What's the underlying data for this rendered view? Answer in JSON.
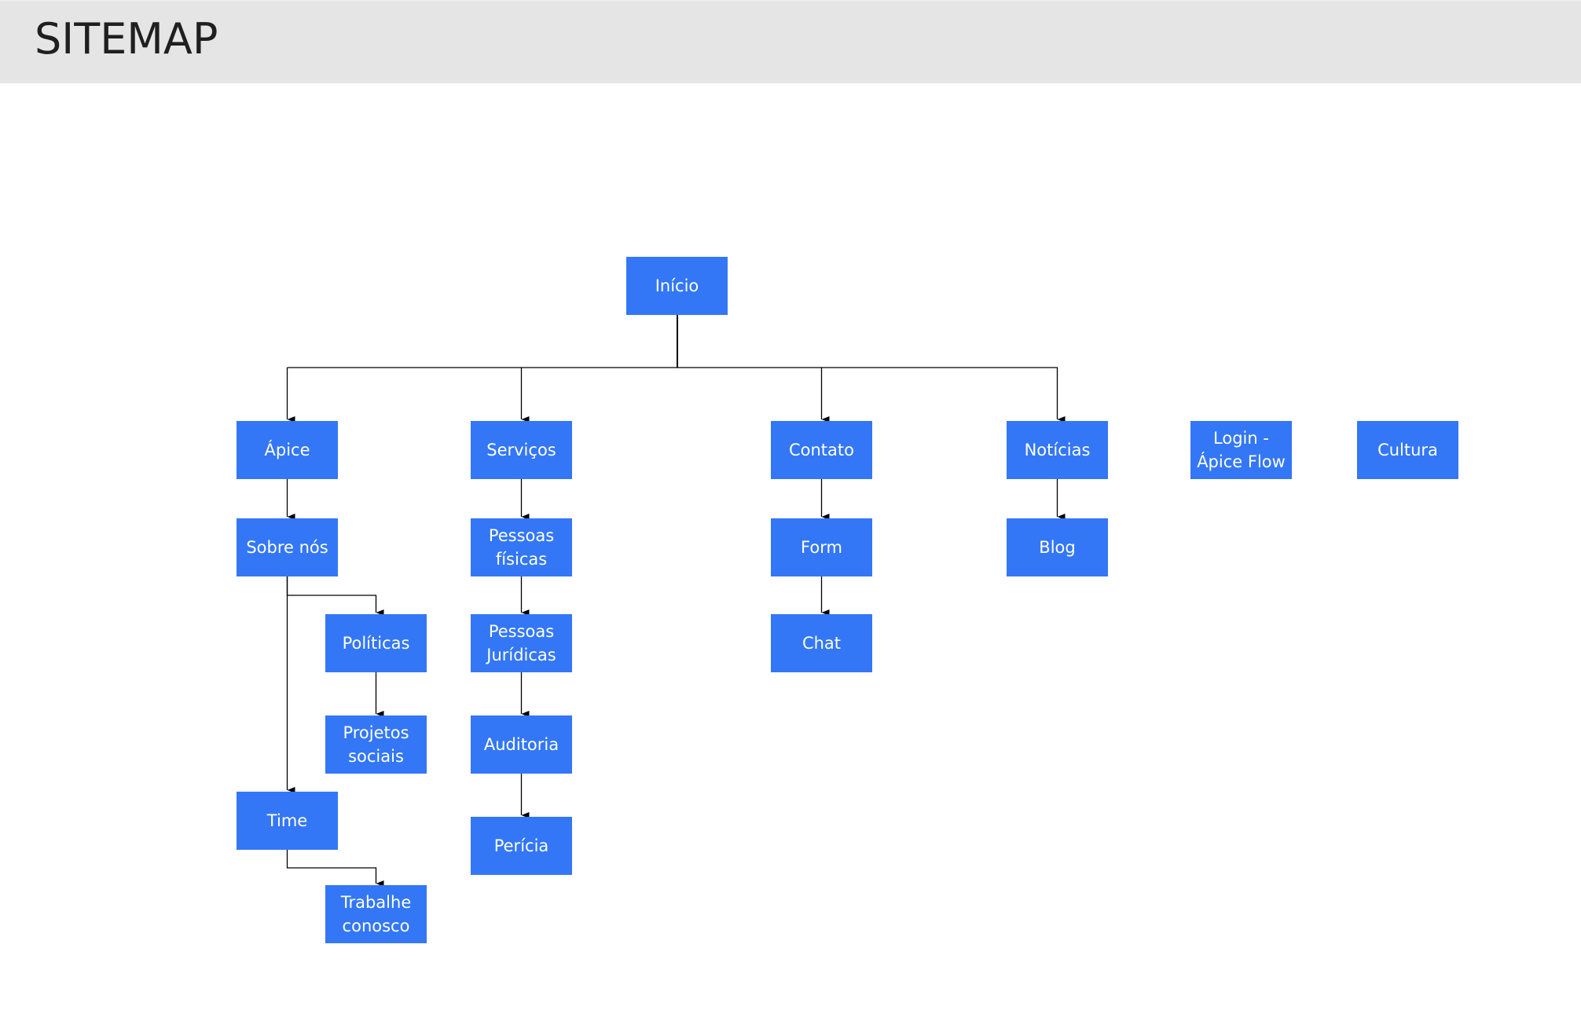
{
  "header": {
    "title": "SITEMAP"
  },
  "colors": {
    "node_fill": "#3377f6",
    "node_text": "#ffffff",
    "header_bg": "#e5e5e5",
    "connector": "#000000"
  },
  "sitemap": {
    "root": {
      "id": "inicio",
      "label": "Início"
    },
    "nodes": {
      "apice": {
        "label": "Ápice",
        "parent": "inicio"
      },
      "servicos": {
        "label": "Serviços",
        "parent": "inicio"
      },
      "contato": {
        "label": "Contato",
        "parent": "inicio"
      },
      "noticias": {
        "label": "Notícias",
        "parent": "inicio"
      },
      "login": {
        "label": "Login -\nÁpice Flow",
        "parent": null
      },
      "cultura": {
        "label": "Cultura",
        "parent": null
      },
      "sobre_nos": {
        "label": "Sobre nós",
        "parent": "apice"
      },
      "politicas": {
        "label": "Políticas",
        "parent": "sobre_nos"
      },
      "projetos_sociais": {
        "label": "Projetos\nsociais",
        "parent": "politicas"
      },
      "time": {
        "label": "Time",
        "parent": "sobre_nos"
      },
      "trabalhe_conosco": {
        "label": "Trabalhe\nconosco",
        "parent": "time"
      },
      "pessoas_fisicas": {
        "label": "Pessoas\nfísicas",
        "parent": "servicos"
      },
      "pessoas_juridicas": {
        "label": "Pessoas\nJurídicas",
        "parent": "pessoas_fisicas"
      },
      "auditoria": {
        "label": "Auditoria",
        "parent": "pessoas_juridicas"
      },
      "pericia": {
        "label": "Perícia",
        "parent": "auditoria"
      },
      "form": {
        "label": "Form",
        "parent": "contato"
      },
      "chat": {
        "label": "Chat",
        "parent": "form"
      },
      "blog": {
        "label": "Blog",
        "parent": "noticias"
      }
    }
  }
}
